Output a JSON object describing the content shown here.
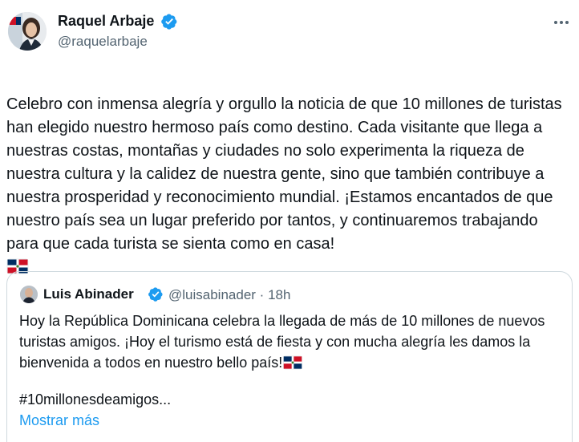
{
  "author": {
    "name": "Raquel Arbaje",
    "handle": "@raquelarbaje",
    "verified": true,
    "verified_color": "#1d9bf0"
  },
  "post": {
    "text": "Celebro con inmensa alegría y orgullo la noticia de que 10 millones de turistas han elegido nuestro hermoso país como destino. Cada visitante que llega a nuestras costas, montañas y ciudades no solo experimenta la riqueza de nuestra cultura y la calidez de nuestra gente, sino que también contribuye a nuestra prosperidad y reconocimiento mundial. ¡Estamos encantados de que nuestro país sea un lugar preferido por tantos, y continuaremos trabajando para que cada turista se sienta como en casa!",
    "emoji": "flag-dominican-republic-icon"
  },
  "quoted": {
    "name": "Luis Abinader",
    "handle": "@luisabinader",
    "separator": "·",
    "time": "18h",
    "verified": true,
    "text": "Hoy la República Dominicana celebra la llegada de más de 10 millones de nuevos turistas amigos. ¡Hoy el turismo está de fiesta y con mucha alegría les damos la bienvenida a todos en nuestro bello país!",
    "hashtag": "#10millonesdeamigos...",
    "show_more": "Mostrar más",
    "emoji": "flag-dominican-republic-icon"
  },
  "colors": {
    "text": "#0f1419",
    "secondary": "#536471",
    "link": "#1d9bf0",
    "border": "#cfd9de",
    "flag_blue": "#002d62",
    "flag_red": "#ce1126"
  }
}
